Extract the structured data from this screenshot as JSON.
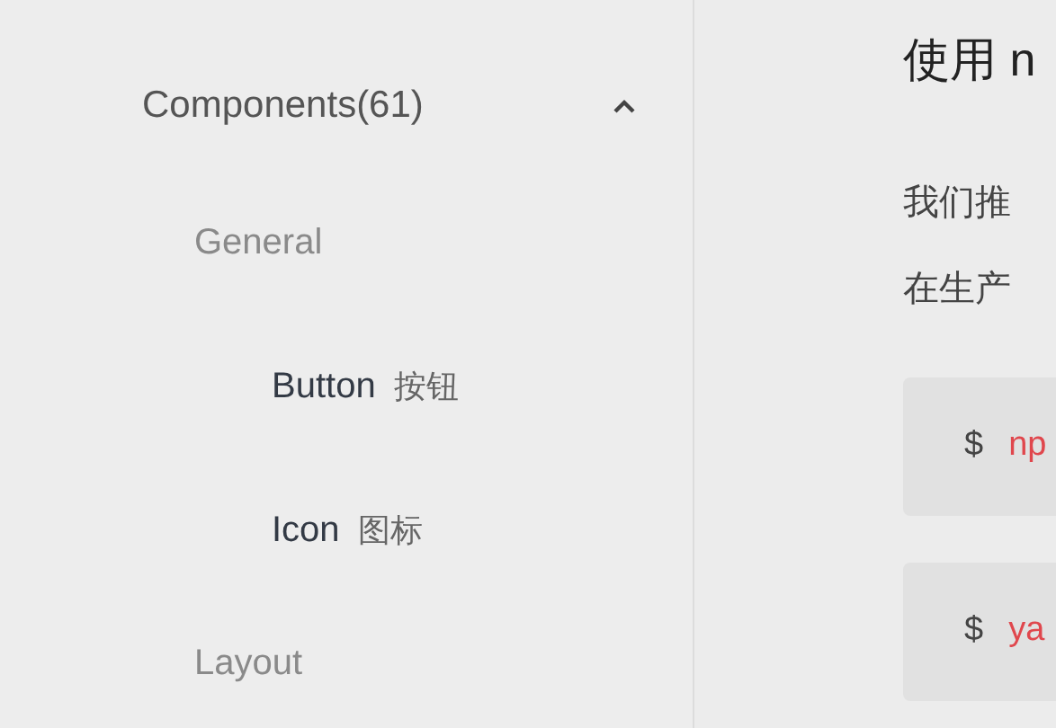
{
  "sidebar": {
    "group": {
      "label": "Components(61)",
      "expanded": true,
      "children": [
        {
          "label": "General",
          "children": [
            {
              "label": "Button",
              "label_zh": "按钮"
            },
            {
              "label": "Icon",
              "label_zh": "图标"
            }
          ]
        },
        {
          "label": "Layout"
        }
      ]
    }
  },
  "content": {
    "heading": "使用 n",
    "paragraph_lines": [
      "我们推",
      "在生产"
    ],
    "code_blocks": [
      {
        "prompt": "$",
        "command": "np"
      },
      {
        "prompt": "$",
        "command": "ya"
      }
    ]
  }
}
